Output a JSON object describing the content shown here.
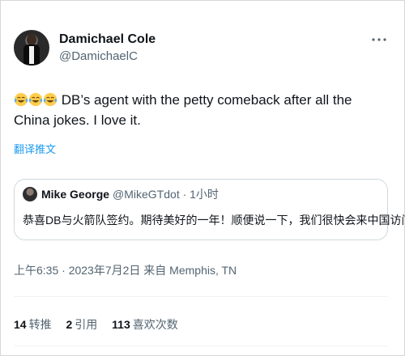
{
  "author": {
    "display_name": "Damichael Cole",
    "handle": "@DamichaelC"
  },
  "tweet": {
    "emoji_name": "joy-emoji",
    "emoji_count": 3,
    "text": "DB’s agent with the petty comeback after all the China jokes. I love it.",
    "translate_label": "翻译推文"
  },
  "quoted_tweet": {
    "display_name": "Mike George",
    "meta": "@MikeGTdot · 1小时",
    "text": "恭喜DB与火箭队签约。期待美好的一年！顺便说一下，我们很快会来中国访问。"
  },
  "timestamp": "上午6:35 · 2023年7月2日 来自 Memphis, TN",
  "stats": [
    {
      "count": "14",
      "label": "转推"
    },
    {
      "count": "2",
      "label": "引用"
    },
    {
      "count": "113",
      "label": "喜欢次数"
    }
  ],
  "colors": {
    "text": "#0f1419",
    "secondary": "#536471",
    "link": "#1d9bf0",
    "border": "#cfd9de"
  },
  "icons": [
    "more-icon",
    "joy-emoji"
  ]
}
